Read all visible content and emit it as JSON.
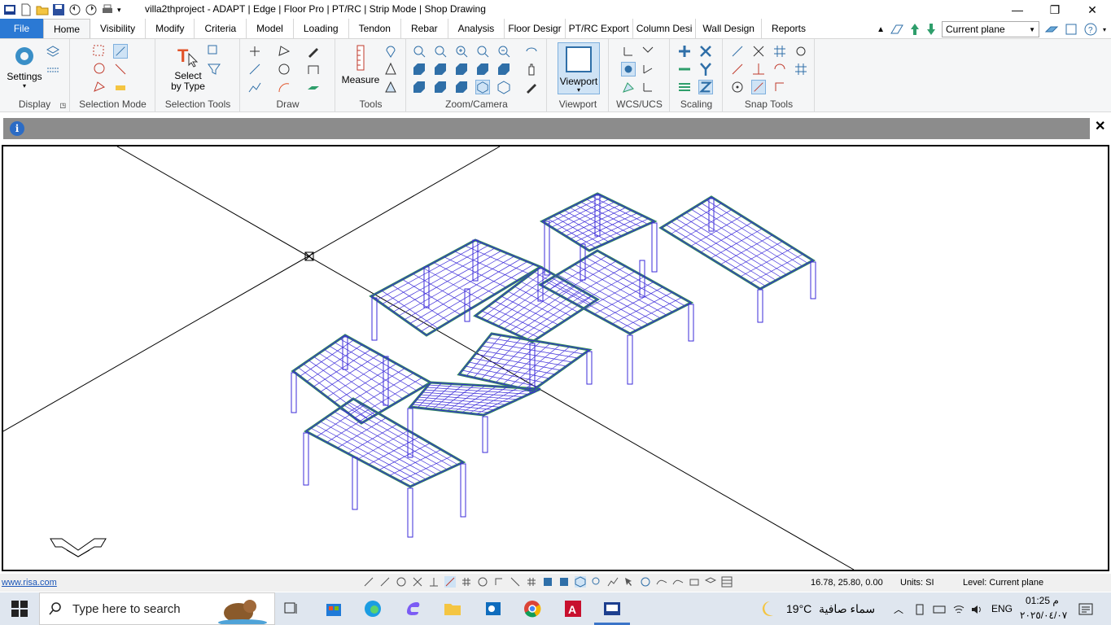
{
  "window": {
    "title": "villa2thproject - ADAPT | Edge | Floor Pro | PT/RC | Strip Mode | Shop Drawing",
    "minimize": "—",
    "restore": "❐",
    "close": "✕"
  },
  "tabs": [
    "File",
    "Home",
    "Visibility",
    "Modify",
    "Criteria",
    "Model",
    "Loading",
    "Tendon",
    "Rebar",
    "Analysis",
    "Floor Desigr",
    "PT/RC Export",
    "Column Desi",
    "Wall Design",
    "Reports"
  ],
  "plane_select": {
    "value": "Current plane"
  },
  "ribbon": {
    "settings_label": "Settings",
    "select_label_1": "Select",
    "select_label_2": "by Type",
    "measure_label": "Measure",
    "viewport_label": "Viewport",
    "groups": [
      "Display",
      "Selection Mode",
      "Selection Tools",
      "Draw",
      "Tools",
      "Zoom/Camera",
      "Viewport",
      "WCS/UCS",
      "Scaling",
      "Snap Tools"
    ]
  },
  "info_icon": "i",
  "info_close": "✕",
  "status": {
    "link": "www.risa.com",
    "coords": "16.78, 25.80, 0.00",
    "units": "Units: SI",
    "level": "Level: Current plane"
  },
  "taskbar": {
    "search_placeholder": "Type here to search",
    "weather_temp": "19°C",
    "weather_desc": "سماء صافية",
    "lang": "ENG",
    "time": "01:25 م",
    "date": "٢٠٢٥/٠٤/٠٧"
  },
  "colors": {
    "file_tab": "#2b79d4",
    "mesh": "#3b2bd9",
    "beam": "#2e8b57",
    "infobar": "#8c8c8c"
  }
}
